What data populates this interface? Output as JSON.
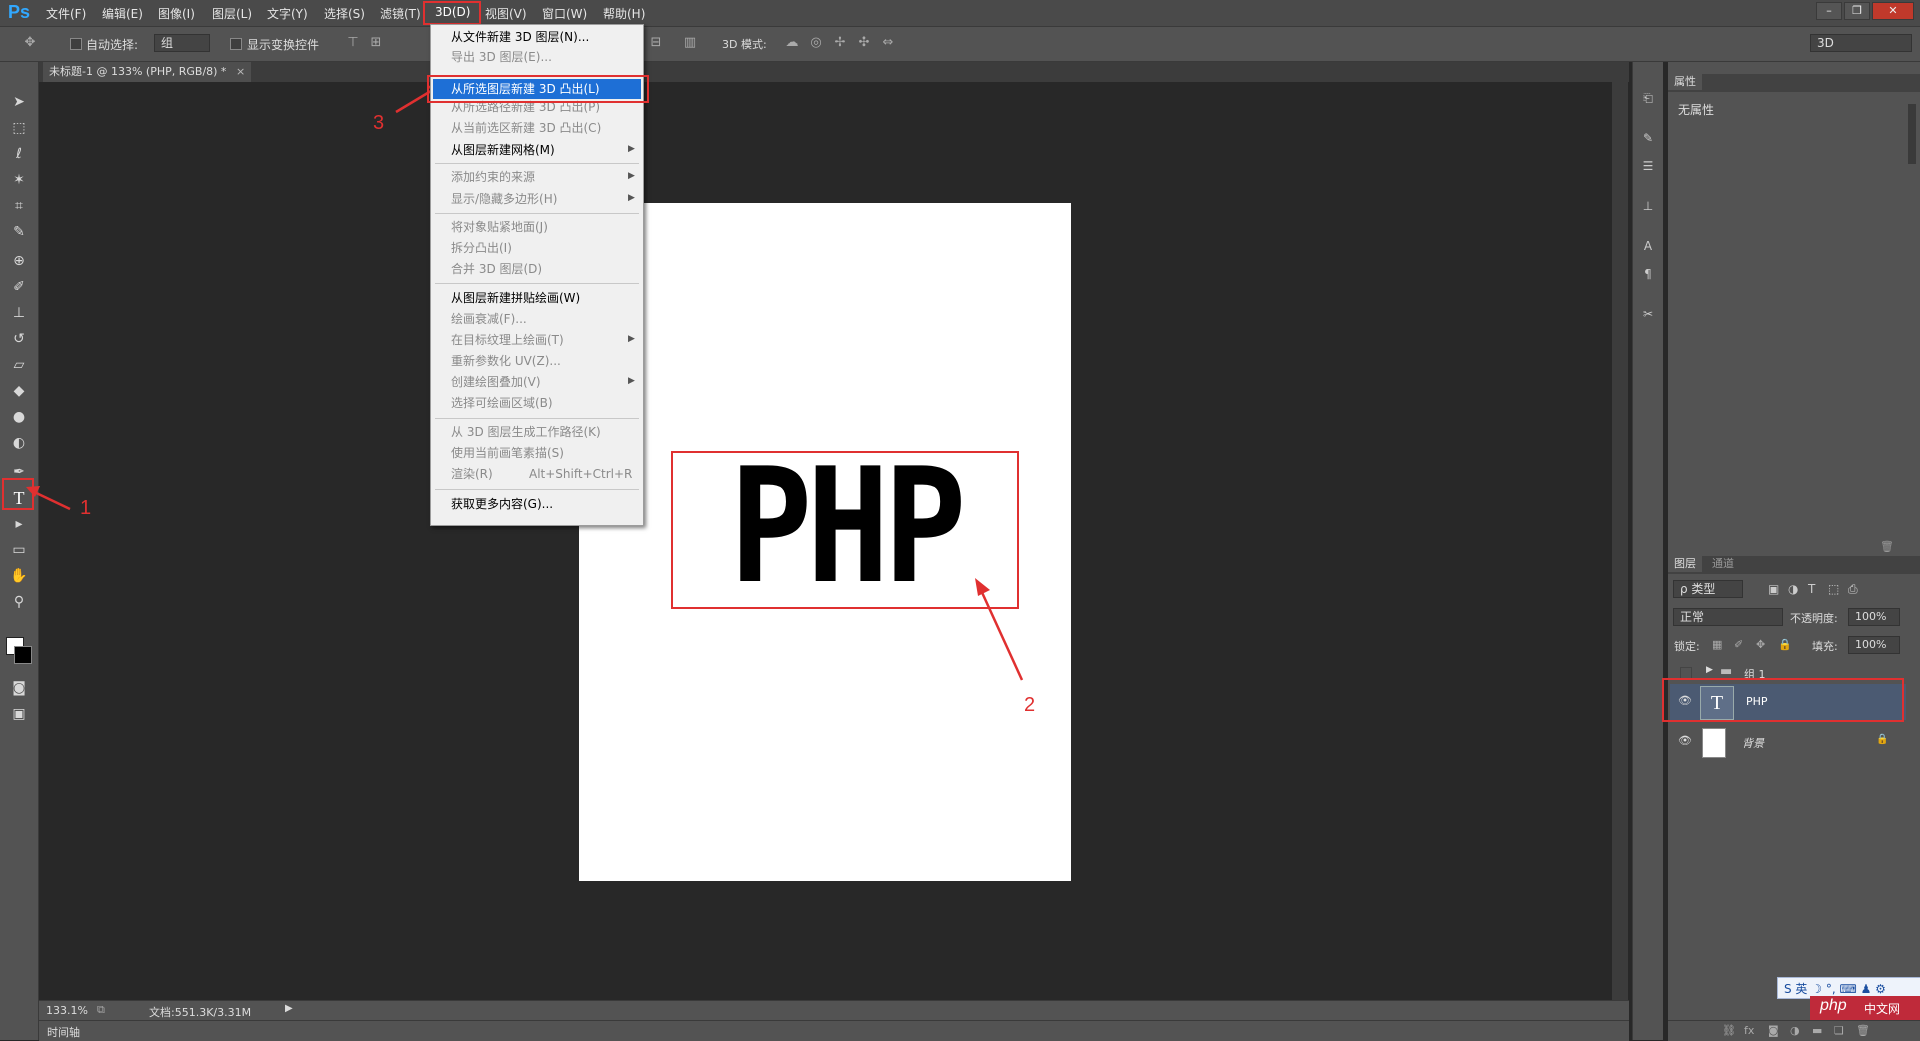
{
  "app": {
    "logo": "Ps"
  },
  "menubar": {
    "items": [
      "文件(F)",
      "编辑(E)",
      "图像(I)",
      "图层(L)",
      "文字(Y)",
      "选择(S)",
      "滤镜(T)",
      "3D(D)",
      "视图(V)",
      "窗口(W)",
      "帮助(H)"
    ]
  },
  "window_controls": {
    "minimize": "–",
    "restore": "❐",
    "close": "✕"
  },
  "options": {
    "auto_select_label": "自动选择:",
    "auto_select_value": "组",
    "show_transform_label": "显示变换控件",
    "mode_3d_label": "3D 模式:",
    "workspace_value": "3D"
  },
  "document": {
    "tab_title": "未标题-1 @ 133% (PHP, RGB/8) *",
    "content_text": "PHP",
    "zoom": "133.1%",
    "doc_size": "文档:551.3K/3.31M",
    "timeline_label": "时间轴"
  },
  "menu_3d": {
    "items": [
      {
        "label": "从文件新建 3D 图层(N)...",
        "enabled": true
      },
      {
        "label": "导出 3D 图层(E)...",
        "enabled": false
      },
      {
        "label": "从所选图层新建 3D 凸出(L)",
        "enabled": true,
        "highlighted": true
      },
      {
        "label": "从所选路径新建 3D 凸出(P)",
        "enabled": false
      },
      {
        "label": "从当前选区新建 3D 凸出(C)",
        "enabled": false
      },
      {
        "label": "从图层新建网格(M)",
        "enabled": true,
        "submenu": true
      },
      {
        "label": "添加约束的来源",
        "enabled": false,
        "submenu": true
      },
      {
        "label": "显示/隐藏多边形(H)",
        "enabled": false,
        "submenu": true
      },
      {
        "label": "将对象贴紧地面(J)",
        "enabled": false
      },
      {
        "label": "拆分凸出(I)",
        "enabled": false
      },
      {
        "label": "合并 3D 图层(D)",
        "enabled": false
      },
      {
        "label": "从图层新建拼贴绘画(W)",
        "enabled": true
      },
      {
        "label": "绘画衰减(F)...",
        "enabled": false
      },
      {
        "label": "在目标纹理上绘画(T)",
        "enabled": false,
        "submenu": true
      },
      {
        "label": "重新参数化 UV(Z)...",
        "enabled": false
      },
      {
        "label": "创建绘图叠加(V)",
        "enabled": false,
        "submenu": true
      },
      {
        "label": "选择可绘画区域(B)",
        "enabled": false
      },
      {
        "label": "从 3D 图层生成工作路径(K)",
        "enabled": false
      },
      {
        "label": "使用当前画笔素描(S)",
        "enabled": false
      },
      {
        "label": "渲染(R)",
        "enabled": false,
        "shortcut": "Alt+Shift+Ctrl+R"
      },
      {
        "label": "获取更多内容(G)...",
        "enabled": true
      }
    ]
  },
  "annotations": {
    "n1": "1",
    "n2": "2",
    "n3": "3"
  },
  "properties_panel": {
    "tab": "属性",
    "body_text": "无属性"
  },
  "layers_panel": {
    "tabs": [
      "图层",
      "通道"
    ],
    "filter_label": "ρ 类型",
    "blend_mode": "正常",
    "opacity_label": "不透明度:",
    "opacity_value": "100%",
    "lock_label": "锁定:",
    "fill_label": "填充:",
    "fill_value": "100%",
    "layers": [
      {
        "name": "组 1",
        "type": "group",
        "visible": false
      },
      {
        "name": "PHP",
        "type": "text",
        "visible": true,
        "selected": true,
        "thumb": "T"
      },
      {
        "name": "背景",
        "type": "background",
        "visible": true,
        "locked": true
      }
    ]
  },
  "ime": {
    "text": "S 英 ☽ °, ⌨ ♟ ⚙"
  },
  "watermark": {
    "text": "php",
    "subtext": "中文网"
  },
  "colors": {
    "annotation_red": "#e03030",
    "menu_highlight": "#1e6fd6",
    "ps_blue": "#31a8ff",
    "selected_layer": "#4b5a72"
  }
}
